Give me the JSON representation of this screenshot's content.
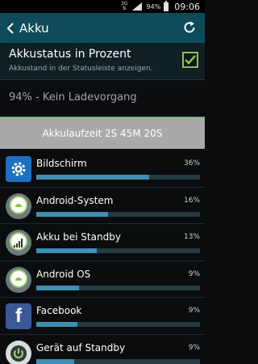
{
  "statusbar": {
    "network": "3G",
    "battery_pct": "94%",
    "time": "09:06"
  },
  "actionbar": {
    "title": "Akku"
  },
  "percent_setting": {
    "label": "Akkustatus in Prozent",
    "subtitle": "Akkustand in der Statusleiste anzeigen.",
    "checked": true
  },
  "charge_status": "94% - Kein Ladevorgang",
  "runtime": "Akkulaufzeit 2S 45M 20S",
  "usage": [
    {
      "name": "Bildschirm",
      "percent_label": "36%",
      "fraction": 0.69,
      "icon": "gear-icon"
    },
    {
      "name": "Android-System",
      "percent_label": "16%",
      "fraction": 0.44,
      "icon": "android-system-icon"
    },
    {
      "name": "Akku bei Standby",
      "percent_label": "13%",
      "fraction": 0.37,
      "icon": "cell-standby-icon"
    },
    {
      "name": "Android OS",
      "percent_label": "9%",
      "fraction": 0.26,
      "icon": "android-os-icon"
    },
    {
      "name": "Facebook",
      "percent_label": "9%",
      "fraction": 0.25,
      "icon": "facebook-icon"
    },
    {
      "name": "Gerät auf Standby",
      "percent_label": "9%",
      "fraction": 0.23,
      "icon": "power-standby-icon"
    }
  ],
  "colors": {
    "actionbar": "#0d4b5a",
    "bar_fill": "#3f8fb3",
    "bar_track": "#263b41",
    "checkbox": "#8fbf4f"
  }
}
